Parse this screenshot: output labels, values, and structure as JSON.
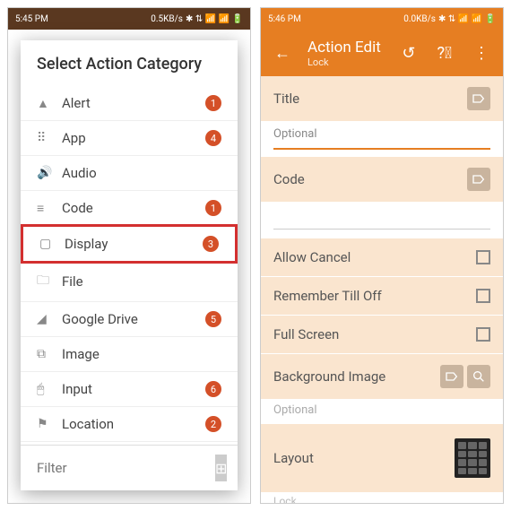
{
  "left": {
    "status": {
      "time": "5:45 PM",
      "net": "0.5KB/s",
      "icons": "✱ ⇅ 📶 📶 🔋"
    },
    "dialog_title": "Select Action Category",
    "categories": [
      {
        "icon": "▲",
        "label": "Alert",
        "badge": "1",
        "hl": false
      },
      {
        "icon": "⠿",
        "label": "App",
        "badge": "4",
        "hl": false
      },
      {
        "icon": "🔊",
        "label": "Audio",
        "badge": "",
        "hl": false
      },
      {
        "icon": "≡",
        "label": "Code",
        "badge": "1",
        "hl": false
      },
      {
        "icon": "▢",
        "label": "Display",
        "badge": "3",
        "hl": true
      },
      {
        "icon": "🗀",
        "label": "File",
        "badge": "",
        "hl": false
      },
      {
        "icon": "◢",
        "label": "Google Drive",
        "badge": "5",
        "hl": false
      },
      {
        "icon": "⧉",
        "label": "Image",
        "badge": "",
        "hl": false
      },
      {
        "icon": "🖱",
        "label": "Input",
        "badge": "6",
        "hl": false
      },
      {
        "icon": "⚑",
        "label": "Location",
        "badge": "2",
        "hl": false
      }
    ],
    "filter_placeholder": "Filter"
  },
  "right": {
    "status": {
      "time": "5:46 PM",
      "net": "0.0KB/s",
      "icons": "✱ ⇅ 📶 📶 🔋"
    },
    "appbar": {
      "title": "Action Edit",
      "subtitle": "Lock"
    },
    "sections": {
      "title": "Title",
      "title_val": "Optional",
      "code": "Code",
      "allow_cancel": "Allow Cancel",
      "remember": "Remember Till Off",
      "fullscreen": "Full Screen",
      "bg_image": "Background Image",
      "bg_val": "Optional",
      "layout": "Layout",
      "lock": "Lock"
    }
  }
}
